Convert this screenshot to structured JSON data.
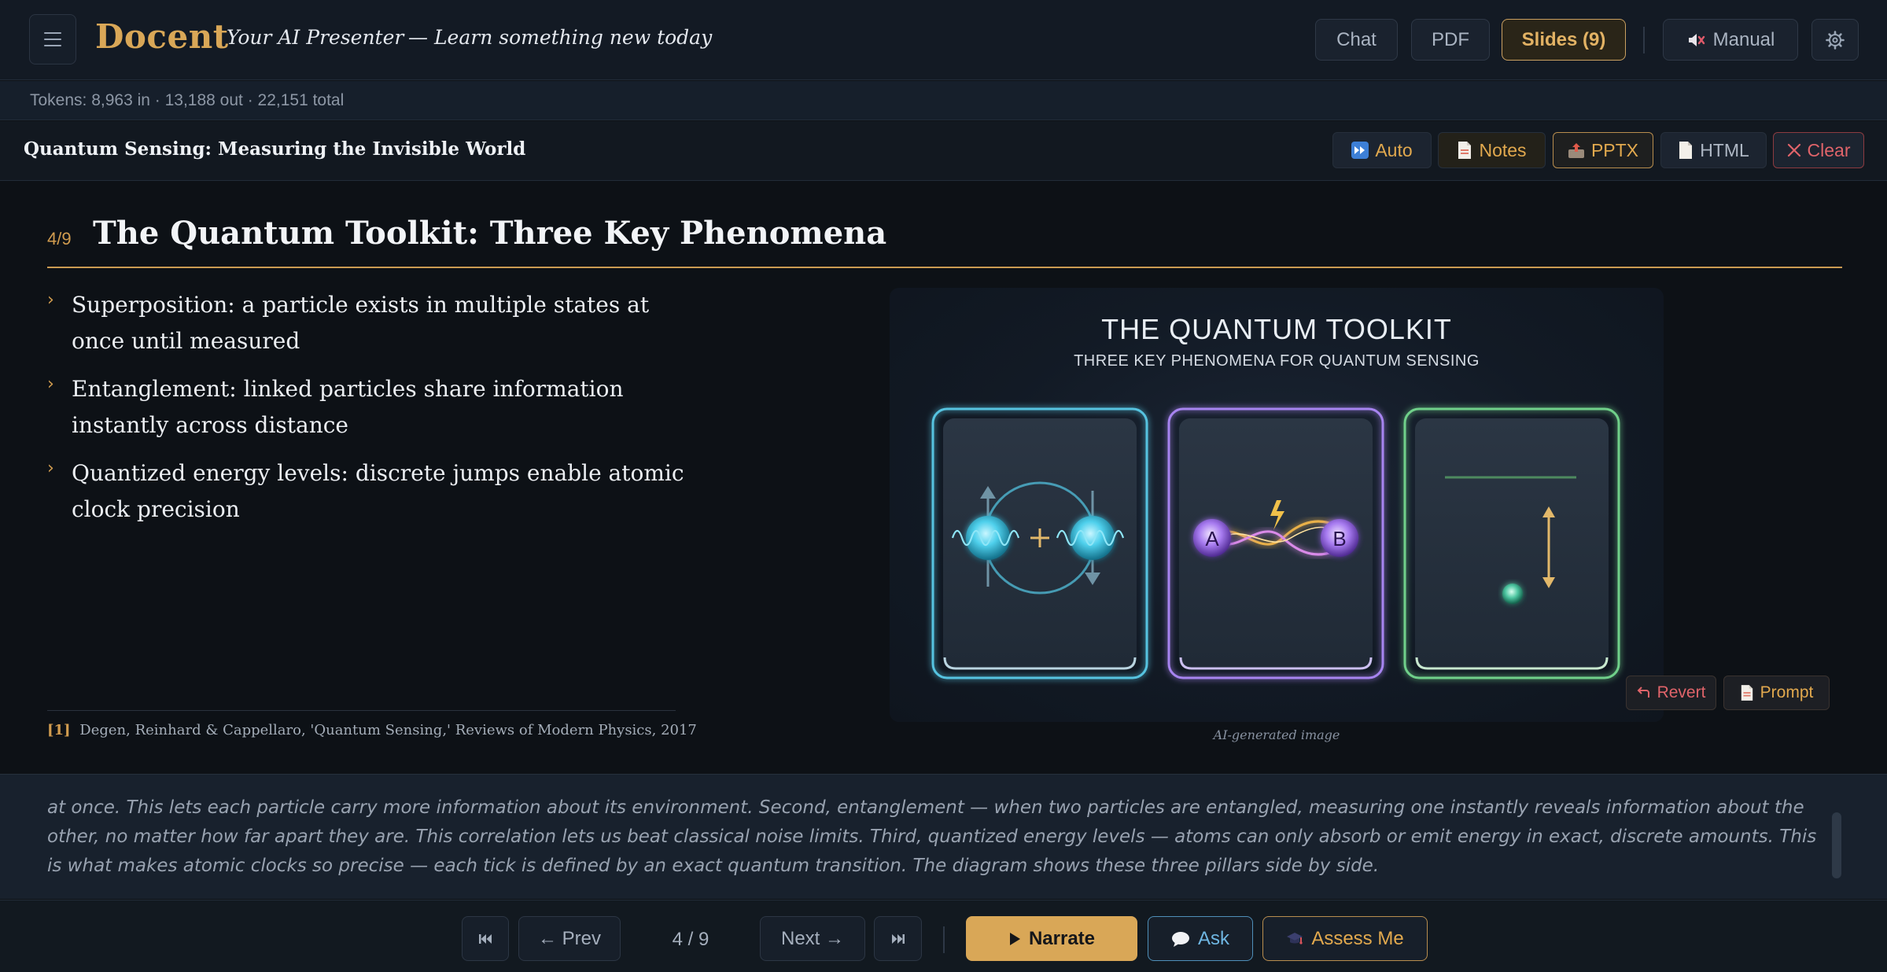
{
  "header": {
    "brand": "Docent",
    "tagline": "Your AI Presenter",
    "subtitle": "— Learn something new today",
    "buttons": {
      "chat": "Chat",
      "pdf": "PDF",
      "slides": "Slides (9)",
      "manual": "Manual"
    }
  },
  "tokens": "Tokens: 8,963 in · 13,188 out · 22,151 total",
  "deck": {
    "title": "Quantum Sensing: Measuring the Invisible World",
    "buttons": {
      "auto": "Auto",
      "notes": "Notes",
      "pptx": "PPTX",
      "html": "HTML",
      "clear": "Clear"
    }
  },
  "slide": {
    "number": "4/9",
    "title": "The Quantum Toolkit: Three Key Phenomena",
    "bullets": [
      "Superposition: a particle exists in multiple states at once until measured",
      "Entanglement: linked particles share information instantly across distance",
      "Quantized energy levels: discrete jumps enable atomic clock precision"
    ],
    "citation": {
      "marker": "[1]",
      "text": "Degen, Reinhard & Cappellaro, 'Quantum Sensing,' Reviews of Modern Physics, 2017"
    },
    "image": {
      "title": "THE QUANTUM TOOLKIT",
      "subtitle": "THREE KEY PHENOMENA FOR QUANTUM SENSING",
      "label_a": "A",
      "label_b": "B",
      "caption": "AI-generated image",
      "revert": "Revert",
      "prompt": "Prompt",
      "card_colors": [
        "#56c3e0",
        "#a784f0",
        "#6fd08a"
      ]
    }
  },
  "narration": "at once. This lets each particle carry more information about its environment. Second, entanglement — when two particles are entangled, measuring one instantly reveals information about the other, no matter how far apart they are. This correlation lets us beat classical noise limits. Third, quantized energy levels — atoms can only absorb or emit energy in exact, discrete amounts. This is what makes atomic clocks so precise — each tick is defined by an exact quantum transition. The diagram shows these three pillars side by side.",
  "nav": {
    "prev": "← Prev",
    "page": "4 / 9",
    "next": "Next →",
    "narrate": "Narrate",
    "ask": "Ask",
    "assess": "Assess Me"
  },
  "colors": {
    "accent": "#d9a757",
    "background": "#0e1217",
    "narrate_button": "#d9a757",
    "ask_border": "#4f8fb8",
    "clear_red": "#e0646a"
  }
}
